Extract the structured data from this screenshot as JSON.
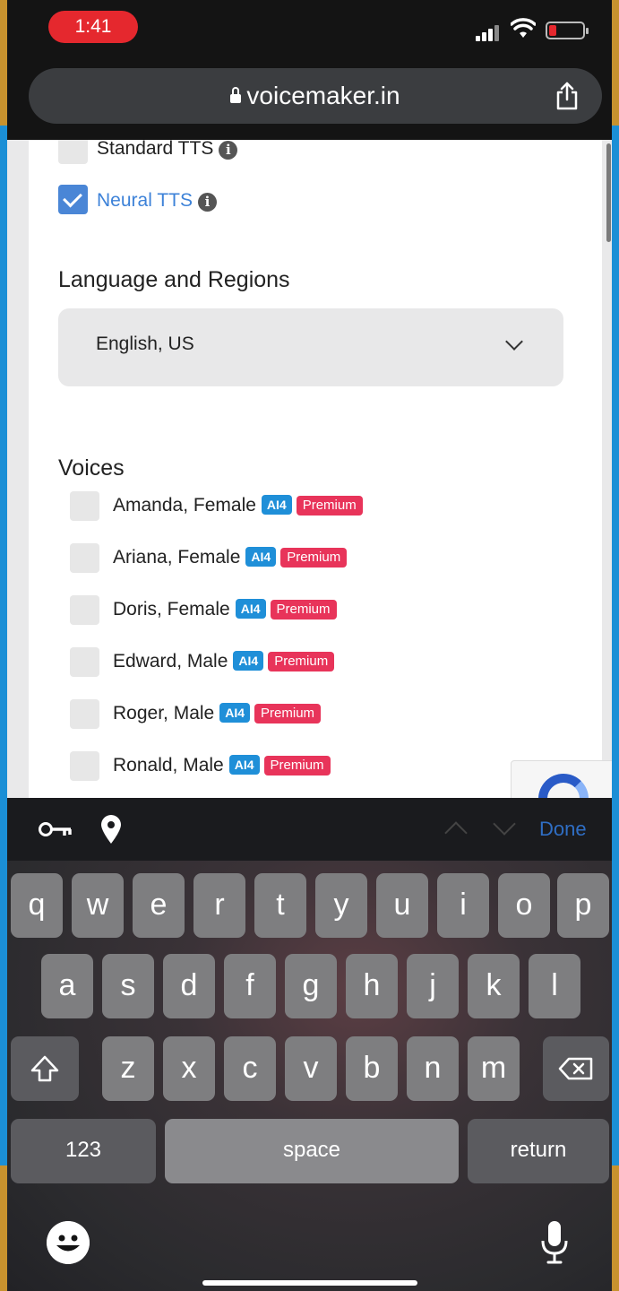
{
  "status_bar": {
    "time": "1:41"
  },
  "browser": {
    "url": "voicemaker.in"
  },
  "engine_options": [
    {
      "label": "Standard TTS",
      "checked": false
    },
    {
      "label": "Neural TTS",
      "checked": true
    }
  ],
  "language": {
    "title": "Language and Regions",
    "selected": "English, US"
  },
  "voices": {
    "title": "Voices",
    "items": [
      {
        "name": "Amanda, Female",
        "engine": "AI4",
        "tier": "Premium"
      },
      {
        "name": "Ariana, Female",
        "engine": "AI4",
        "tier": "Premium"
      },
      {
        "name": "Doris, Female",
        "engine": "AI4",
        "tier": "Premium"
      },
      {
        "name": "Edward, Male",
        "engine": "AI4",
        "tier": "Premium"
      },
      {
        "name": "Roger, Male",
        "engine": "AI4",
        "tier": "Premium"
      },
      {
        "name": "Ronald, Male",
        "engine": "AI4",
        "tier": "Premium"
      }
    ]
  },
  "accessory_bar": {
    "done_label": "Done"
  },
  "keyboard": {
    "row1": [
      "q",
      "w",
      "e",
      "r",
      "t",
      "y",
      "u",
      "i",
      "o",
      "p"
    ],
    "row2": [
      "a",
      "s",
      "d",
      "f",
      "g",
      "h",
      "j",
      "k",
      "l"
    ],
    "row3": [
      "z",
      "x",
      "c",
      "v",
      "b",
      "n",
      "m"
    ],
    "numbers_label": "123",
    "space_label": "space",
    "return_label": "return"
  },
  "colors": {
    "accent": "#3d82d8",
    "ai_badge": "#1f8fd8",
    "premium_badge": "#e8345a",
    "time_pill": "#e5282e"
  }
}
